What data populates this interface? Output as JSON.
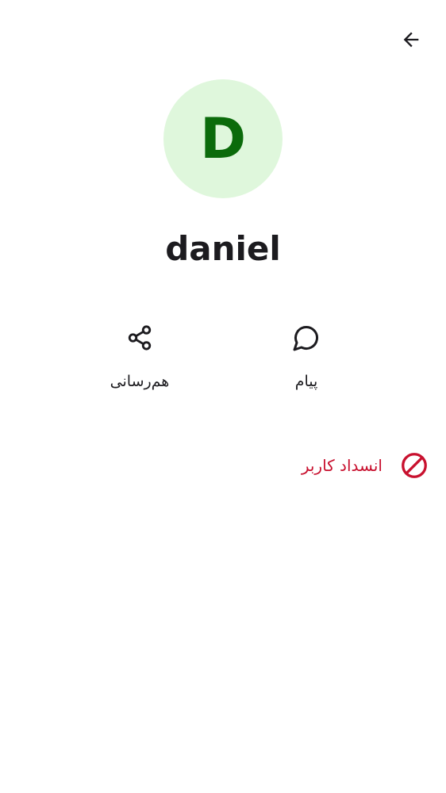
{
  "header": {
    "back_icon": "arrow-back-icon"
  },
  "profile": {
    "avatar_letter": "D",
    "avatar_bg": "#dff7dc",
    "avatar_fg": "#0b6b0b",
    "name": "daniel"
  },
  "actions": [
    {
      "id": "share",
      "label": "هم‌رسانی",
      "icon": "share-icon"
    },
    {
      "id": "message",
      "label": "پیام",
      "icon": "chat-bubble-icon"
    }
  ],
  "block": {
    "label": "انسداد کاربر",
    "icon": "block-icon",
    "color": "#c8102e"
  }
}
